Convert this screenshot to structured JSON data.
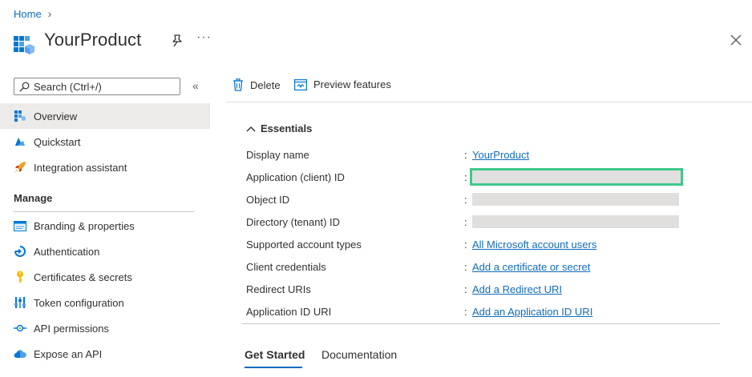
{
  "breadcrumb": {
    "home": "Home"
  },
  "header": {
    "title": "YourProduct",
    "more": "···"
  },
  "sidebar": {
    "search_placeholder": "Search (Ctrl+/)",
    "collapse": "«",
    "items": [
      {
        "label": "Overview"
      },
      {
        "label": "Quickstart"
      },
      {
        "label": "Integration assistant"
      }
    ],
    "manage_title": "Manage",
    "manage_items": [
      {
        "label": "Branding & properties"
      },
      {
        "label": "Authentication"
      },
      {
        "label": "Certificates & secrets"
      },
      {
        "label": "Token configuration"
      },
      {
        "label": "API permissions"
      },
      {
        "label": "Expose an API"
      }
    ]
  },
  "toolbar": {
    "delete_label": "Delete",
    "preview_label": "Preview features"
  },
  "essentials": {
    "title": "Essentials",
    "rows": [
      {
        "label": "Display name",
        "value": "YourProduct"
      },
      {
        "label": "Application (client) ID",
        "value": ""
      },
      {
        "label": "Object ID",
        "value": ""
      },
      {
        "label": "Directory (tenant) ID",
        "value": ""
      },
      {
        "label": "Supported account types",
        "value": "All Microsoft account users"
      },
      {
        "label": "Client credentials",
        "value": "Add a certificate or secret"
      },
      {
        "label": "Redirect URIs",
        "value": "Add a Redirect URI"
      },
      {
        "label": "Application ID URI",
        "value": "Add an Application ID URI"
      }
    ],
    "colon": ":"
  },
  "tabs": [
    {
      "label": "Get Started"
    },
    {
      "label": "Documentation"
    }
  ],
  "colors": {
    "accent": "#0f6cbd",
    "highlight": "#3ec98d",
    "active_bg": "#edebe9"
  }
}
